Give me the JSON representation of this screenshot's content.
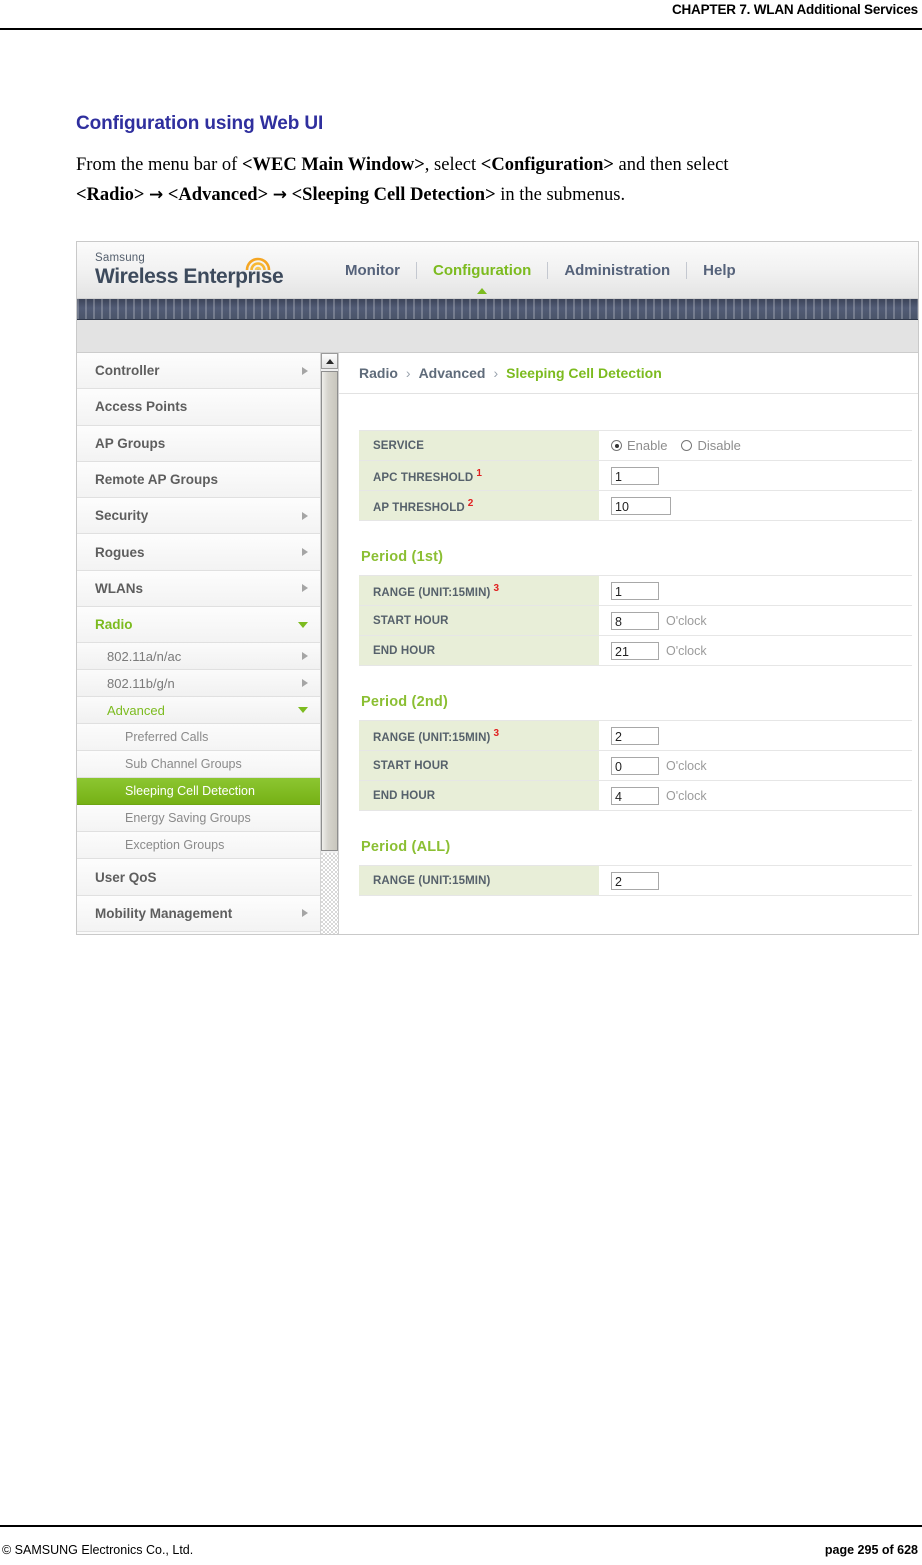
{
  "document": {
    "header_title": "CHAPTER 7. WLAN Additional Services",
    "footer_left": "© SAMSUNG Electronics Co., Ltd.",
    "footer_right": "page 295 of 628",
    "section_title": "Configuration using Web UI",
    "paragraph": {
      "p1": "From the menu bar of ",
      "b1": "<WEC Main Window>",
      "p2": ", select ",
      "b2": "<Configuration>",
      "p3": " and then select",
      "b3": "<Radio>",
      "arrow1": "→",
      "b4": "<Advanced>",
      "arrow2": "→",
      "b5": "<Sleeping Cell Detection>",
      "p4": " in the submenus."
    }
  },
  "app": {
    "brand": {
      "small": "Samsung",
      "main": "Wireless Enterprise",
      "wifi_icon": "wifi-arc-icon"
    },
    "nav": [
      {
        "label": "Monitor",
        "active": false
      },
      {
        "label": "Configuration",
        "active": true
      },
      {
        "label": "Administration",
        "active": false
      },
      {
        "label": "Help",
        "active": false
      }
    ],
    "sidebar": [
      {
        "label": "Controller",
        "level": 1,
        "caret": "right",
        "selected": false
      },
      {
        "label": "Access Points",
        "level": 1,
        "caret": "none",
        "selected": false
      },
      {
        "label": "AP Groups",
        "level": 1,
        "caret": "none",
        "selected": false
      },
      {
        "label": "Remote AP Groups",
        "level": 1,
        "caret": "none",
        "selected": false
      },
      {
        "label": "Security",
        "level": 1,
        "caret": "right",
        "selected": false
      },
      {
        "label": "Rogues",
        "level": 1,
        "caret": "right",
        "selected": false
      },
      {
        "label": "WLANs",
        "level": 1,
        "caret": "right",
        "selected": false
      },
      {
        "label": "Radio",
        "level": 1,
        "caret": "down",
        "selected": false,
        "green": true
      },
      {
        "label": "802.11a/n/ac",
        "level": 2,
        "caret": "right",
        "selected": false
      },
      {
        "label": "802.11b/g/n",
        "level": 2,
        "caret": "right",
        "selected": false
      },
      {
        "label": "Advanced",
        "level": 2,
        "caret": "down",
        "selected": false,
        "green": true
      },
      {
        "label": "Preferred Calls",
        "level": 3,
        "caret": "none",
        "selected": false
      },
      {
        "label": "Sub Channel Groups",
        "level": 3,
        "caret": "none",
        "selected": false
      },
      {
        "label": "Sleeping Cell Detection",
        "level": 3,
        "caret": "none",
        "selected": true
      },
      {
        "label": "Energy Saving Groups",
        "level": 3,
        "caret": "none",
        "selected": false
      },
      {
        "label": "Exception Groups",
        "level": 3,
        "caret": "none",
        "selected": false
      },
      {
        "label": "User QoS",
        "level": 1,
        "caret": "none",
        "selected": false
      },
      {
        "label": "Mobility Management",
        "level": 1,
        "caret": "right",
        "selected": false
      }
    ],
    "breadcrumb": {
      "item1": "Radio",
      "sep1": "›",
      "item2": "Advanced",
      "sep2": "›",
      "item3": "Sleeping Cell Detection"
    },
    "form": {
      "service": {
        "label": "SERVICE",
        "enable_label": "Enable",
        "disable_label": "Disable",
        "selected": "Enable"
      },
      "apc_threshold": {
        "label": "APC THRESHOLD",
        "footnote": "1",
        "value": "1"
      },
      "ap_threshold": {
        "label": "AP THRESHOLD",
        "footnote": "2",
        "value": "10"
      },
      "period_1st": {
        "heading": "Period (1st)",
        "range": {
          "label": "RANGE (UNIT:15MIN)",
          "footnote": "3",
          "value": "1"
        },
        "start_hour": {
          "label": "START HOUR",
          "value": "8",
          "unit": "O'clock"
        },
        "end_hour": {
          "label": "END HOUR",
          "value": "21",
          "unit": "O'clock"
        }
      },
      "period_2nd": {
        "heading": "Period (2nd)",
        "range": {
          "label": "RANGE (UNIT:15MIN)",
          "footnote": "3",
          "value": "2"
        },
        "start_hour": {
          "label": "START HOUR",
          "value": "0",
          "unit": "O'clock"
        },
        "end_hour": {
          "label": "END HOUR",
          "value": "4",
          "unit": "O'clock"
        }
      },
      "period_all": {
        "heading": "Period (ALL)",
        "range": {
          "label": "RANGE (UNIT:15MIN)",
          "value": "2"
        }
      }
    },
    "scrollbar": {
      "up_arrow_icon": "scroll-up-arrow-icon"
    }
  },
  "colors": {
    "brand_green": "#7cbb1f",
    "label_cell_bg": "#e8eed8",
    "nav_strip": "#4a5469",
    "heading_blue": "#2f2f9e"
  }
}
